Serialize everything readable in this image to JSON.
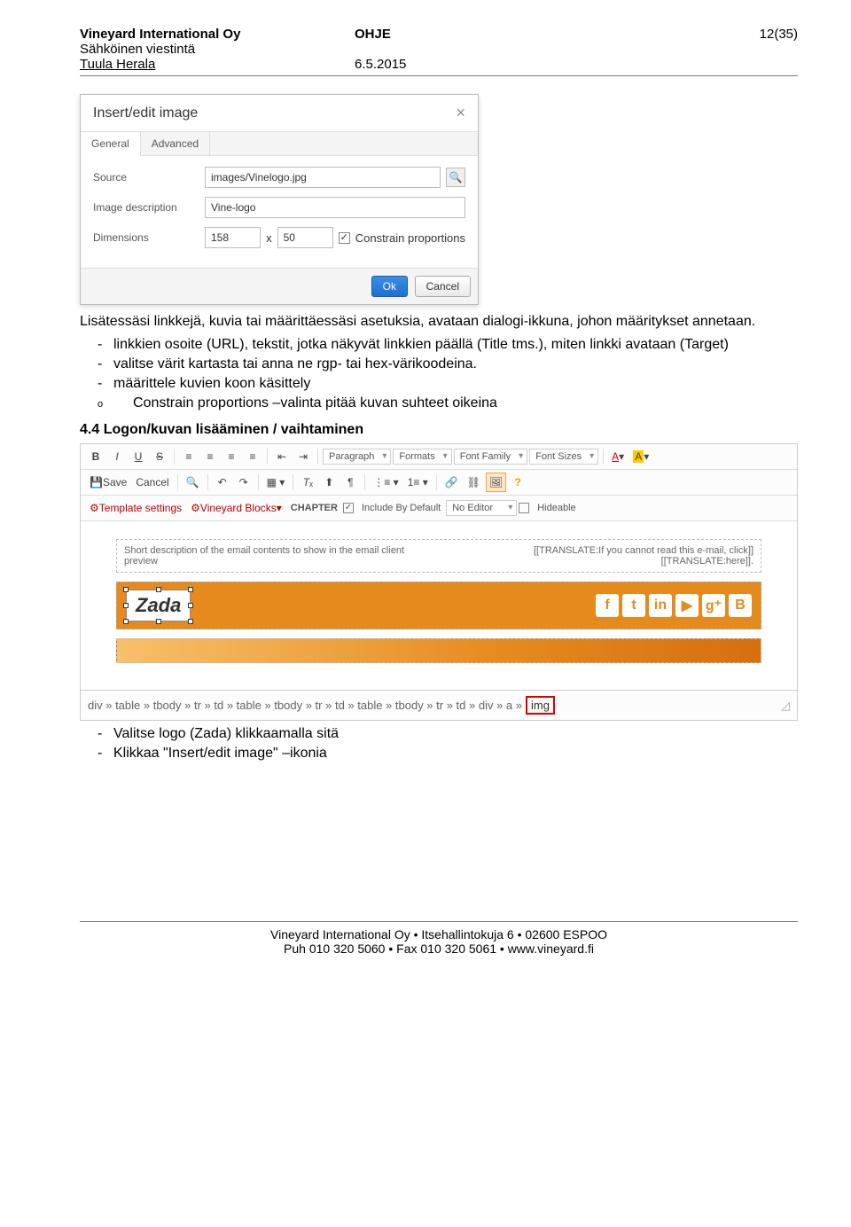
{
  "header": {
    "company": "Vineyard International Oy",
    "docType": "OHJE",
    "pageNum": "12(35)",
    "dept": "Sähköinen viestintä",
    "author": "Tuula Herala",
    "date": "6.5.2015"
  },
  "dialog": {
    "title": "Insert/edit image",
    "tabs": {
      "general": "General",
      "advanced": "Advanced"
    },
    "labels": {
      "source": "Source",
      "desc": "Image description",
      "dim": "Dimensions",
      "x": "x",
      "constrain": "Constrain proportions"
    },
    "values": {
      "source": "images/Vinelogo.jpg",
      "desc": "Vine-logo",
      "w": "158",
      "h": "50"
    },
    "buttons": {
      "ok": "Ok",
      "cancel": "Cancel"
    }
  },
  "body": {
    "p1": "Lisätessäsi linkkejä, kuvia tai määrittäessäsi asetuksia, avataan dialogi-ikkuna, johon määritykset annetaan.",
    "li1": "linkkien osoite (URL), tekstit, jotka näkyvät linkkien päällä (Title tms.), miten linkki avataan (Target)",
    "li2": "valitse värit kartasta tai anna ne rgp- tai hex-värikoodeina.",
    "li3": "määrittele kuvien koon käsittely",
    "li3a": "Constrain proportions –valinta pitää kuvan suhteet oikeina",
    "sec": "4.4 Logon/kuvan lisääminen / vaihtaminen",
    "li4": "Valitse logo (Zada) klikkaamalla sitä",
    "li5": "Klikkaa \"Insert/edit image\" –ikonia"
  },
  "editor": {
    "row1": {
      "paragraph": "Paragraph",
      "formats": "Formats",
      "fontfam": "Font Family",
      "fontsize": "Font Sizes"
    },
    "row2": {
      "save": "Save",
      "cancel": "Cancel"
    },
    "row3": {
      "tpl": "Template settings",
      "blocks": "Vineyard Blocks",
      "chapter": "CHAPTER",
      "include": "Include By Default",
      "noeditor": "No Editor",
      "hideable": "Hideable"
    },
    "desc": {
      "left": "Short description of the email contents to show in the email client preview",
      "right": "[[TRANSLATE:If you cannot read this e-mail, click]] [[TRANSLATE:here]]."
    },
    "zada": "Zada",
    "path": "div » table » tbody » tr » td » table » tbody » tr » td » table » tbody » tr » td » div » a »",
    "pathLast": "img"
  },
  "footer": {
    "l1": "Vineyard International Oy • Itsehallintokuja 6 • 02600 ESPOO",
    "l2": "Puh 010 320 5060 • Fax 010 320 5061 • www.vineyard.fi"
  }
}
